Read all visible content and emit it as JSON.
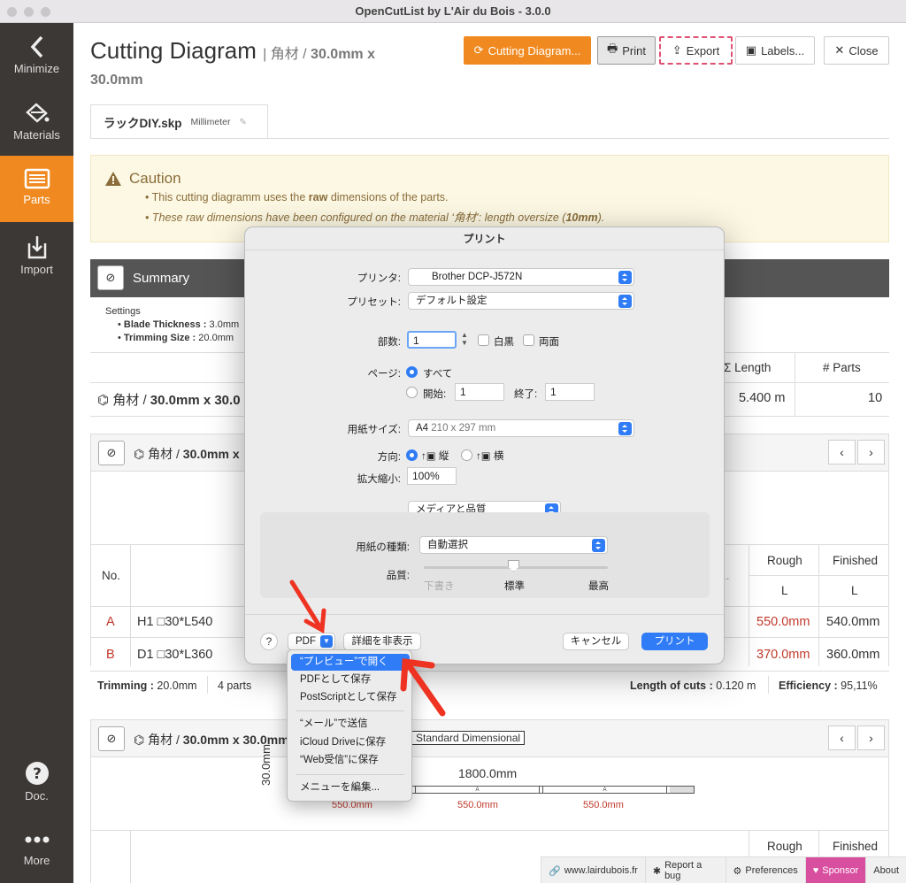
{
  "window": {
    "title": "OpenCutList by L'Air du Bois - 3.0.0"
  },
  "sidebar": {
    "items": [
      {
        "label": "Minimize",
        "icon": "chevron-left-icon"
      },
      {
        "label": "Materials",
        "icon": "paint-bucket-icon"
      },
      {
        "label": "Parts",
        "icon": "list-icon"
      },
      {
        "label": "Import",
        "icon": "import-icon"
      },
      {
        "label": "Doc.",
        "icon": "question-icon"
      },
      {
        "label": "More",
        "icon": "dots-icon"
      }
    ]
  },
  "header": {
    "title": "Cutting Diagram",
    "subtitle_prefix": "| 角材 / ",
    "subtitle_bold": "30.0mm x",
    "subtitle_line2": "30.0mm",
    "buttons": {
      "cutting": "Cutting Diagram...",
      "print": "Print",
      "export": "Export",
      "labels": "Labels...",
      "close": "Close"
    }
  },
  "tab": {
    "file": "ラックDIY.skp",
    "unit": "Millimeter"
  },
  "caution": {
    "title": "Caution",
    "line1_pre": "This cutting diagramm uses the ",
    "line1_bold": "raw",
    "line1_post": " dimensions of the parts.",
    "line2_pre": "These raw dimensions have been configured on the material ‘角材’: length oversize (",
    "line2_bold": "10mm",
    "line2_post": ")."
  },
  "summary": {
    "title": "Summary",
    "settings_label": "Settings",
    "blade_label": "Blade Thickness :",
    "blade_value": "3.0mm",
    "trim_label": "Trimming Size :",
    "trim_value": "20.0mm",
    "col_length": "Σ Length",
    "col_parts": "# Parts",
    "row_material": "角材 / ",
    "row_dims": "30.0mm x 30.0",
    "row_length": "5.400 m",
    "row_parts": "10"
  },
  "bar1": {
    "title_pre": "角材 / ",
    "title_bold": "30.0mm x",
    "col_no": "No.",
    "col_rough": "Rough",
    "col_finished": "Finished",
    "col_l": "L",
    "col_dot": "..",
    "rows": [
      {
        "id": "A",
        "name": "H1 □30*L540",
        "rough": "550.0mm",
        "finished": "540.0mm"
      },
      {
        "id": "B",
        "name": "D1 □30*L360",
        "rough": "370.0mm",
        "finished": "360.0mm"
      }
    ],
    "trimming_label": "Trimming :",
    "trimming_value": "20.0mm",
    "parts_count": "4 parts",
    "cuts_label": "Length of cuts :",
    "cuts_value": "0.120 m",
    "eff_label": "Efficiency :",
    "eff_value": "95,11%"
  },
  "bar2": {
    "title_pre": "角材 / ",
    "title_bold": "30.0mm x 30.0mm",
    "std_badge": "Standard Dimensional",
    "length_label": "1800.0mm",
    "width_label": "30.0mm",
    "part_letter": "A",
    "part_lengths": [
      "550.0mm",
      "550.0mm",
      "550.0mm"
    ],
    "col_rough": "Rough",
    "col_finished": "Finished"
  },
  "footer": {
    "site": "www.lairdubois.fr",
    "bug": "Report a bug",
    "prefs": "Preferences",
    "sponsor": "Sponsor",
    "about": "About"
  },
  "print_dialog": {
    "title": "プリント",
    "printer_label": "プリンタ:",
    "printer_value": "Brother DCP-J572N",
    "preset_label": "プリセット:",
    "preset_value": "デフォルト設定",
    "copies_label": "部数:",
    "copies_value": "1",
    "bw_label": "白黒",
    "duplex_label": "両面",
    "pages_label": "ページ:",
    "pages_all": "すべて",
    "pages_from": "開始:",
    "from_value": "1",
    "pages_to": "終了:",
    "to_value": "1",
    "paper_label": "用紙サイズ:",
    "paper_value": "A4",
    "paper_dims": "210 x 297 mm",
    "orient_label": "方向:",
    "orient_portrait": "縦",
    "orient_landscape": "横",
    "scale_label": "拡大縮小:",
    "scale_value": "100%",
    "section_popup": "メディアと品質",
    "media_label": "用紙の種類:",
    "media_value": "自動選択",
    "quality_label": "品質:",
    "quality_low": "下書き",
    "quality_mid": "標準",
    "quality_high": "最高",
    "help": "?",
    "pdf": "PDF",
    "hide_details": "詳細を非表示",
    "cancel": "キャンセル",
    "print": "プリント"
  },
  "pdf_menu": {
    "items": [
      "“プレビュー”で開く",
      "PDFとして保存",
      "PostScriptとして保存",
      "“メール”で送信",
      "iCloud Driveに保存",
      "“Web受信”に保存",
      "メニューを編集..."
    ]
  }
}
